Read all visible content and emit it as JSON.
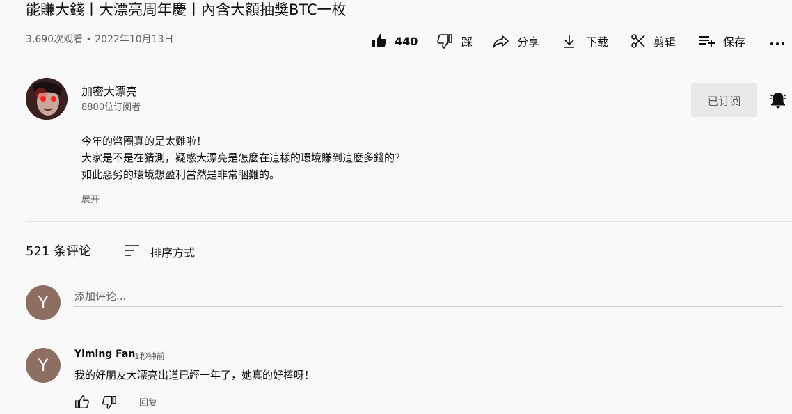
{
  "video": {
    "title": "能賺大錢丨大漂亮周年慶丨內含大額抽獎BTC一枚",
    "meta": "3,690次观看 • 2022年10月13日"
  },
  "actions": {
    "like_count": "440",
    "dislike_label": "踩",
    "share_label": "分享",
    "download_label": "下载",
    "clip_label": "剪辑",
    "save_label": "保存"
  },
  "channel": {
    "name": "加密大漂亮",
    "subscribers": "8800位订阅者",
    "subscribe_label": "已订阅"
  },
  "description": {
    "lines": [
      "今年的幣圈真的是太難啦！",
      "大家是不是在猜測，疑惑大漂亮是怎麼在這樣的環境賺到這麼多錢的？",
      "如此惡劣的環境想盈利當然是非常睏難的。"
    ],
    "expand_label": "展开"
  },
  "comments": {
    "count_label": "521 条评论",
    "sort_label": "排序方式",
    "add_placeholder": "添加评论...",
    "my_avatar_letter": "Y",
    "items": [
      {
        "avatar_letter": "Y",
        "author": "Yiming Fan",
        "time": "1秒钟前",
        "text": "我的好朋友大漂亮出道已經一年了，她真的好棒呀！",
        "reply_label": "回复"
      }
    ]
  },
  "colors": {
    "avatar_bg": "#8d6e63",
    "subscribe_bg": "#e9e9e9",
    "secondary_text": "#606060"
  }
}
